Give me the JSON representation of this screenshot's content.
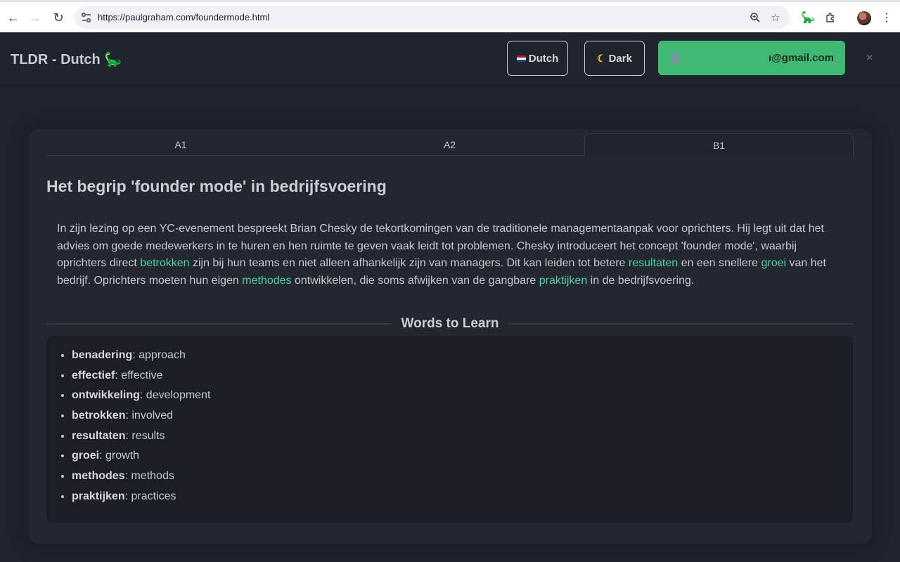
{
  "browser": {
    "url": "https://paulgraham.com/foundermode.html"
  },
  "header": {
    "title": "TLDR - Dutch 🦕",
    "language_label": "Dutch",
    "theme_label": "Dark",
    "user_email": "\u0000@gmail.com",
    "close_label": "×"
  },
  "tabs": [
    {
      "label": "A1"
    },
    {
      "label": "A2"
    },
    {
      "label": "B1",
      "active": true
    }
  ],
  "article": {
    "title": "Het begrip 'founder mode' in bedrijfsvoering",
    "segments": [
      {
        "text": "In zijn lezing op een YC-evenement bespreekt Brian Chesky de tekortkomingen van de traditionele managementaanpak voor oprichters. Hij legt uit dat het advies om goede medewerkers in te huren en hen ruimte te geven vaak leidt tot problemen. Chesky introduceert het concept 'founder mode', waarbij oprichters direct "
      },
      {
        "text": "betrokken",
        "highlight": true
      },
      {
        "text": " zijn bij hun teams en niet alleen afhankelijk zijn van managers. Dit kan leiden tot betere "
      },
      {
        "text": "resultaten",
        "highlight": true
      },
      {
        "text": " en een snellere "
      },
      {
        "text": "groei",
        "highlight": true
      },
      {
        "text": " van het bedrijf. Oprichters moeten hun eigen "
      },
      {
        "text": "methodes",
        "highlight": true
      },
      {
        "text": " ontwikkelen, die soms afwijken van de gangbare "
      },
      {
        "text": "praktijken",
        "highlight": true
      },
      {
        "text": " in de bedrijfsvoering."
      }
    ]
  },
  "words": {
    "title": "Words to Learn",
    "items": [
      {
        "term": "benadering",
        "translation": ": approach"
      },
      {
        "term": "effectief",
        "translation": ": effective"
      },
      {
        "term": "ontwikkeling",
        "translation": ": development"
      },
      {
        "term": "betrokken",
        "translation": ": involved"
      },
      {
        "term": "resultaten",
        "translation": ": results"
      },
      {
        "term": "groei",
        "translation": ": growth"
      },
      {
        "term": "methodes",
        "translation": ": methods"
      },
      {
        "term": "praktijken",
        "translation": ": practices"
      }
    ]
  },
  "colors": {
    "highlight": "#4fd1a5",
    "user_button": "#3fb873",
    "background": "#1f232c"
  }
}
